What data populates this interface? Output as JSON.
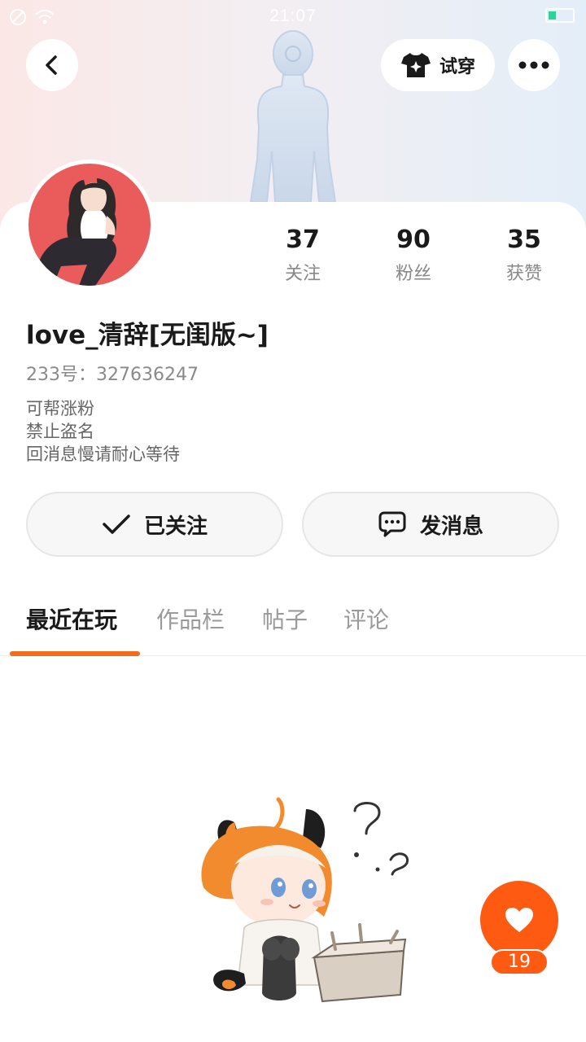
{
  "status_bar": {
    "time": "21:07",
    "icons": [
      "no-sim-icon",
      "wifi-icon",
      "battery-icon"
    ]
  },
  "header": {
    "back_icon": "chevron-left-icon",
    "tryon_label": "试穿",
    "tryon_icon": "tshirt-sparkle-icon",
    "more_icon": "more-dots-icon"
  },
  "profile": {
    "stats": [
      {
        "value": "37",
        "label": "关注"
      },
      {
        "value": "90",
        "label": "粉丝"
      },
      {
        "value": "35",
        "label": "获赞"
      }
    ],
    "username": "love_清辞[无闺版~]",
    "uid": "233号：327636247",
    "bio": [
      "可帮涨粉",
      "禁止盗名",
      "回消息慢请耐心等待"
    ]
  },
  "actions": {
    "follow_label": "已关注",
    "follow_icon": "check-icon",
    "message_label": "发消息",
    "message_icon": "chat-bubble-icon"
  },
  "tabs": [
    "最近在玩",
    "作品栏",
    "帖子",
    "评论"
  ],
  "active_tab": 0,
  "like": {
    "count": "19",
    "icon": "heart-icon"
  },
  "colors": {
    "accent": "#ff5a12",
    "tab_underline": "#f26a1b",
    "avatar_bg": "#ea5b5c"
  }
}
